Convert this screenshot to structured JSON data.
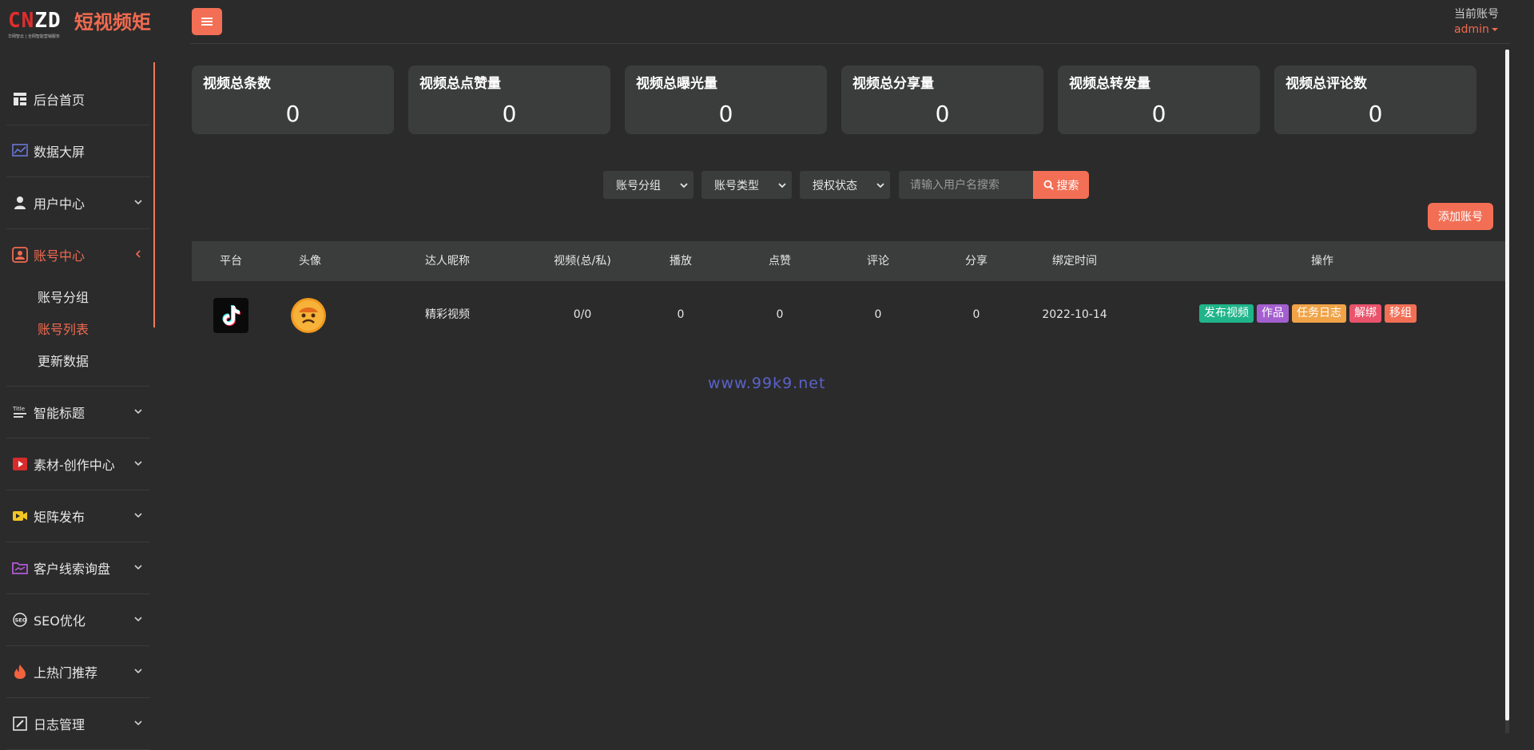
{
  "brand": {
    "mark_left": "CN",
    "mark_right": "ZD",
    "subtitle": "华网智云 | 全网智能营销服务",
    "title": "短视频矩"
  },
  "sidebar": {
    "items": [
      {
        "label": "后台首页",
        "icon": "grid-icon"
      },
      {
        "label": "数据大屏",
        "icon": "chart-icon"
      },
      {
        "label": "用户中心",
        "icon": "user-icon"
      },
      {
        "label": "账号中心",
        "icon": "account-icon",
        "active": true
      },
      {
        "label": "智能标题",
        "icon": "title-icon"
      },
      {
        "label": "素材-创作中心",
        "icon": "play-icon"
      },
      {
        "label": "矩阵发布",
        "icon": "video-icon"
      },
      {
        "label": "客户线索询盘",
        "icon": "folder-icon"
      },
      {
        "label": "SEO优化",
        "icon": "seo-icon"
      },
      {
        "label": "上热门推荐",
        "icon": "fire-icon"
      },
      {
        "label": "日志管理",
        "icon": "log-icon"
      }
    ],
    "submenu": [
      {
        "label": "账号分组"
      },
      {
        "label": "账号列表",
        "active": true
      },
      {
        "label": "更新数据"
      }
    ]
  },
  "header": {
    "account_label": "当前账号",
    "username": "admin"
  },
  "stats": [
    {
      "title": "视频总条数",
      "value": "0"
    },
    {
      "title": "视频总点赞量",
      "value": "0"
    },
    {
      "title": "视频总曝光量",
      "value": "0"
    },
    {
      "title": "视频总分享量",
      "value": "0"
    },
    {
      "title": "视频总转发量",
      "value": "0"
    },
    {
      "title": "视频总评论数",
      "value": "0"
    }
  ],
  "filters": {
    "group": "账号分组",
    "type": "账号类型",
    "auth": "授权状态",
    "search_placeholder": "请输入用户名搜索",
    "search_button": "搜索"
  },
  "add_account": "添加账号",
  "table": {
    "headers": [
      "平台",
      "头像",
      "达人昵称",
      "视频(总/私)",
      "播放",
      "点赞",
      "评论",
      "分享",
      "绑定时间",
      "操作"
    ],
    "rows": [
      {
        "nickname": "精彩视频",
        "videos": "0/0",
        "plays": "0",
        "likes": "0",
        "comments": "0",
        "shares": "0",
        "bind_time": "2022-10-14",
        "actions": [
          "发布视频",
          "作品",
          "任务日志",
          "解绑",
          "移组"
        ]
      }
    ]
  },
  "watermark": "www.99k9.net",
  "colors": {
    "accent": "#f26f55",
    "background": "#2b2b2c",
    "card": "#3b3c3c"
  }
}
